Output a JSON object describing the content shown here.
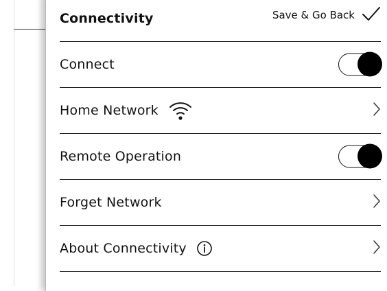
{
  "header": {
    "title": "Connectivity",
    "save_label": "Save & Go Back"
  },
  "rows": [
    {
      "label": "Connect",
      "control": "toggle",
      "on": true
    },
    {
      "label": "Home Network",
      "icon": "wifi-icon",
      "control": "chevron"
    },
    {
      "label": "Remote Operation",
      "control": "toggle",
      "on": true
    },
    {
      "label": "Forget Network",
      "control": "chevron"
    },
    {
      "label": "About Connectivity",
      "icon": "info-icon",
      "control": "chevron"
    }
  ],
  "colors": {
    "text": "#111111",
    "divider": "#222222",
    "toggle_on": "#000000"
  }
}
